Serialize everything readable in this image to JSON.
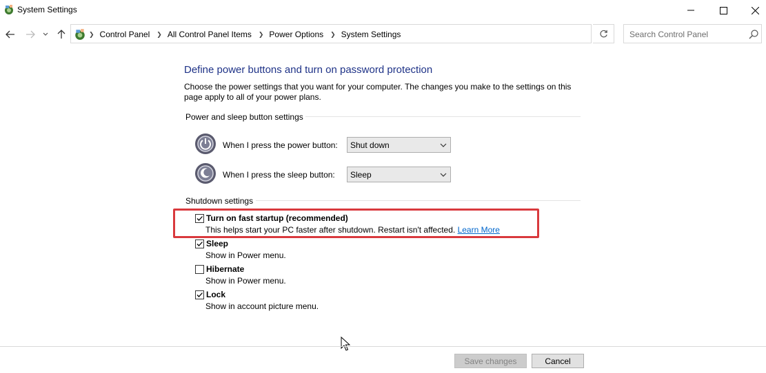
{
  "window": {
    "title": "System Settings",
    "icon": "control-panel-icon"
  },
  "navigation": {
    "breadcrumbs": [
      "Control Panel",
      "All Control Panel Items",
      "Power Options",
      "System Settings"
    ],
    "search_placeholder": "Search Control Panel"
  },
  "page": {
    "heading": "Define power buttons and turn on password protection",
    "description": "Choose the power settings that you want for your computer. The changes you make to the settings on this page apply to all of your power plans."
  },
  "power_section": {
    "header": "Power and sleep button settings",
    "rows": [
      {
        "label": "When I press the power button:",
        "value": "Shut down",
        "icon": "power-button-icon"
      },
      {
        "label": "When I press the sleep button:",
        "value": "Sleep",
        "icon": "sleep-button-icon"
      }
    ]
  },
  "shutdown_section": {
    "header": "Shutdown settings",
    "items": [
      {
        "title": "Turn on fast startup (recommended)",
        "description": "This helps start your PC faster after shutdown. Restart isn't affected.",
        "link": "Learn More",
        "checked": true,
        "highlighted": true
      },
      {
        "title": "Sleep",
        "description": "Show in Power menu.",
        "checked": true
      },
      {
        "title": "Hibernate",
        "description": "Show in Power menu.",
        "checked": false
      },
      {
        "title": "Lock",
        "description": "Show in account picture menu.",
        "checked": true
      }
    ]
  },
  "buttons": {
    "save": "Save changes",
    "cancel": "Cancel"
  },
  "colors": {
    "heading": "#1e3287",
    "highlight": "#d9393d",
    "link": "#0066cc"
  }
}
